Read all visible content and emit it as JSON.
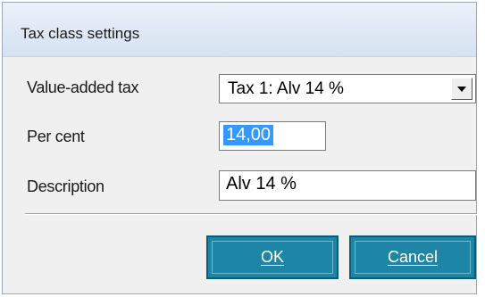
{
  "window": {
    "title": "Tax class settings"
  },
  "form": {
    "vat_label": "Value-added tax",
    "vat_selected": "Tax 1: Alv 14 %",
    "percent_label": "Per cent",
    "percent_value": "14,00",
    "description_label": "Description",
    "description_value": "Alv 14 %"
  },
  "buttons": {
    "ok_label": "OK",
    "cancel_label": "Cancel"
  },
  "colors": {
    "button_bg": "#1d85a6",
    "selection": "#3399ff"
  }
}
